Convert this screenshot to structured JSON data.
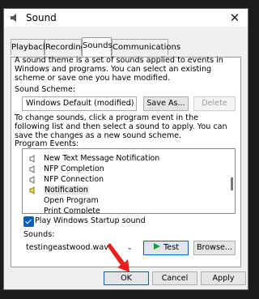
{
  "window": {
    "title": "Sound",
    "close_glyph": "✕"
  },
  "tabs": [
    {
      "label": "Playback"
    },
    {
      "label": "Recording"
    },
    {
      "label": "Sounds"
    },
    {
      "label": "Communications"
    }
  ],
  "sounds": {
    "intro": "A sound theme is a set of sounds applied to events in Windows and programs.  You can select an existing scheme or save one you have modified.",
    "scheme_label": "Sound Scheme:",
    "scheme_value": "Windows Default (modified)",
    "save_as_label": "Save As...",
    "delete_label": "Delete",
    "change_text": "To change sounds, click a program event in the following list and then select a sound to apply.  You can save the changes as a new sound scheme.",
    "events_label": "Program Events:",
    "events": [
      {
        "label": "New Text Message Notification",
        "has_icon": true,
        "selected": false
      },
      {
        "label": "NFP Completion",
        "has_icon": true,
        "selected": false
      },
      {
        "label": "NFP Connection",
        "has_icon": true,
        "selected": false
      },
      {
        "label": "Notification",
        "has_icon": true,
        "selected": true
      },
      {
        "label": "Open Program",
        "has_icon": false,
        "selected": false
      },
      {
        "label": "Print Complete",
        "has_icon": false,
        "selected": false
      }
    ],
    "startup_checkbox_label": "Play Windows Startup sound",
    "startup_checked": true,
    "sounds_label": "Sounds:",
    "sound_value": "testingeastwood.wav",
    "test_label": "Test",
    "browse_label": "Browse..."
  },
  "footer": {
    "ok_label": "OK",
    "cancel_label": "Cancel",
    "apply_label": "Apply"
  },
  "colors": {
    "accent": "#0a5fb7",
    "annotation_arrow": "#e8201b",
    "play_icon": "#1a9b2f"
  }
}
